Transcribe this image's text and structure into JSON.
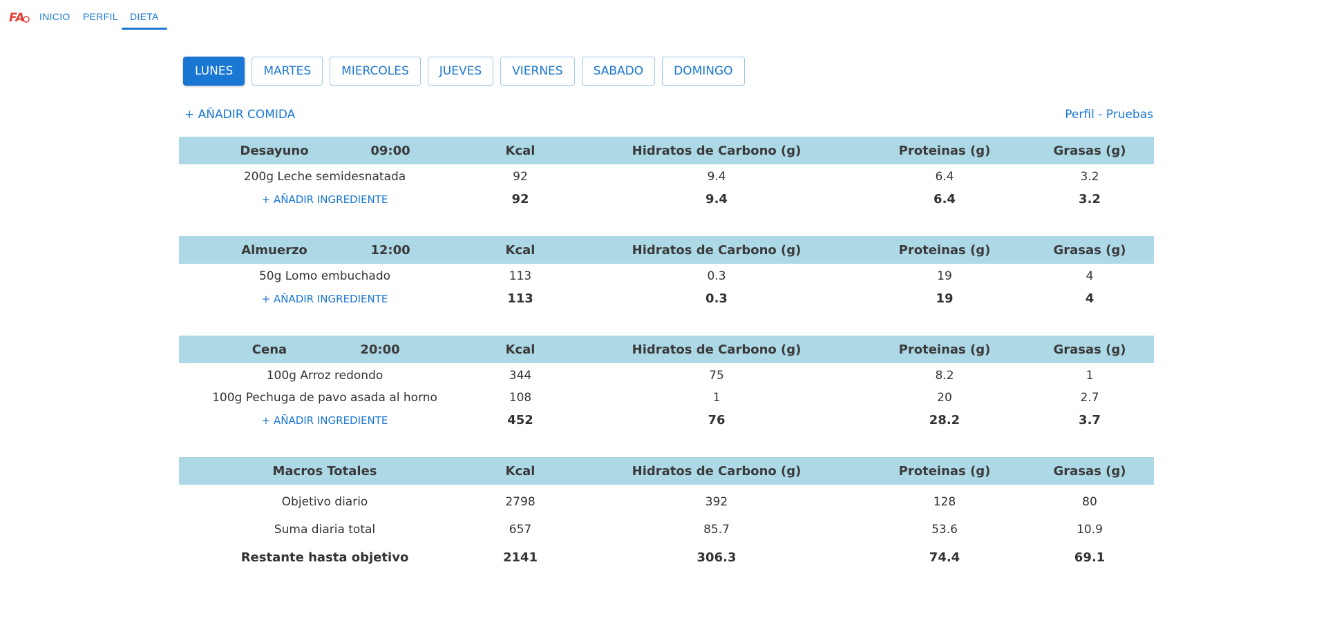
{
  "nav": {
    "logo_text": "FA",
    "items": [
      "INICIO",
      "PERFIL",
      "DIETA"
    ],
    "active": "DIETA"
  },
  "days": [
    "LUNES",
    "MARTES",
    "MIERCOLES",
    "JUEVES",
    "VIERNES",
    "SABADO",
    "DOMINGO"
  ],
  "active_day": "LUNES",
  "add_meal_label": "+ AÑADIR COMIDA",
  "profile_label": "Perfil - Pruebas",
  "columns": {
    "kcal": "Kcal",
    "hc": "Hidratos de Carbono (g)",
    "prot": "Proteinas (g)",
    "gras": "Grasas (g)"
  },
  "add_ingredient_label": "+ AÑADIR INGREDIENTE",
  "meals": [
    {
      "name": "Desayuno",
      "time": "09:00",
      "items": [
        {
          "name": "200g Leche semidesnatada",
          "kcal": "92",
          "hc": "9.4",
          "prot": "6.4",
          "gras": "3.2"
        }
      ],
      "total": {
        "kcal": "92",
        "hc": "9.4",
        "prot": "6.4",
        "gras": "3.2"
      }
    },
    {
      "name": "Almuerzo",
      "time": "12:00",
      "items": [
        {
          "name": "50g Lomo embuchado",
          "kcal": "113",
          "hc": "0.3",
          "prot": "19",
          "gras": "4"
        }
      ],
      "total": {
        "kcal": "113",
        "hc": "0.3",
        "prot": "19",
        "gras": "4"
      }
    },
    {
      "name": "Cena",
      "time": "20:00",
      "items": [
        {
          "name": "100g Arroz redondo",
          "kcal": "344",
          "hc": "75",
          "prot": "8.2",
          "gras": "1"
        },
        {
          "name": "100g Pechuga de pavo asada al horno",
          "kcal": "108",
          "hc": "1",
          "prot": "20",
          "gras": "2.7"
        }
      ],
      "total": {
        "kcal": "452",
        "hc": "76",
        "prot": "28.2",
        "gras": "3.7"
      }
    }
  ],
  "totals": {
    "title": "Macros Totales",
    "rows": [
      {
        "label": "Objetivo diario",
        "kcal": "2798",
        "hc": "392",
        "prot": "128",
        "gras": "80"
      },
      {
        "label": "Suma diaria total",
        "kcal": "657",
        "hc": "85.7",
        "prot": "53.6",
        "gras": "10.9"
      },
      {
        "label": "Restante hasta objetivo",
        "kcal": "2141",
        "hc": "306.3",
        "prot": "74.4",
        "gras": "69.1"
      }
    ]
  },
  "colors": {
    "accent": "#1976d2",
    "header_bg": "#add8e6",
    "logo": "#e53935"
  }
}
